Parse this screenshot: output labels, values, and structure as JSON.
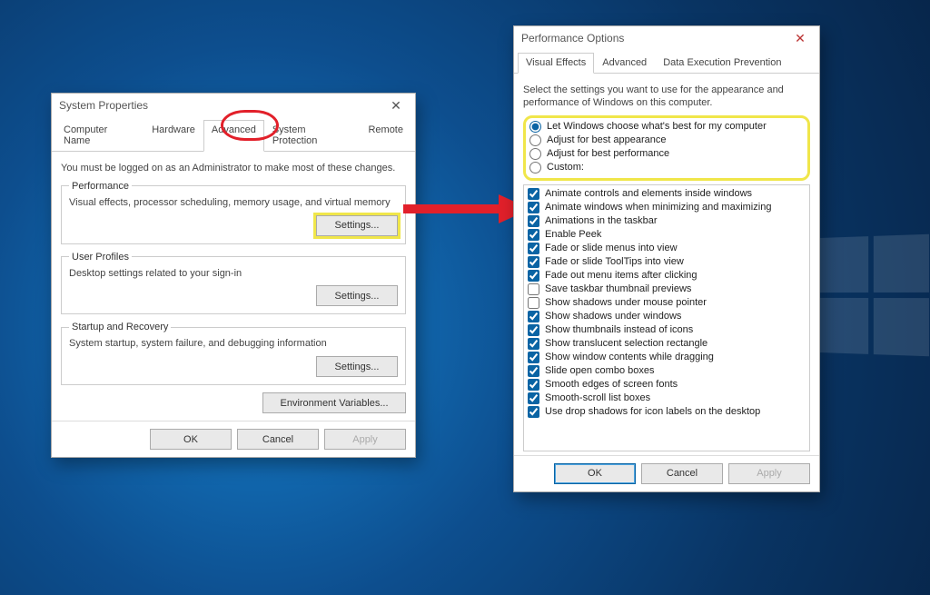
{
  "sysprops": {
    "title": "System Properties",
    "tabs": [
      "Computer Name",
      "Hardware",
      "Advanced",
      "System Protection",
      "Remote"
    ],
    "active_tab": 2,
    "admin_note": "You must be logged on as an Administrator to make most of these changes.",
    "groups": {
      "perf": {
        "legend": "Performance",
        "text": "Visual effects, processor scheduling, memory usage, and virtual memory",
        "btn": "Settings..."
      },
      "profiles": {
        "legend": "User Profiles",
        "text": "Desktop settings related to your sign-in",
        "btn": "Settings..."
      },
      "startup": {
        "legend": "Startup and Recovery",
        "text": "System startup, system failure, and debugging information",
        "btn": "Settings..."
      }
    },
    "env_btn": "Environment Variables...",
    "buttons": {
      "ok": "OK",
      "cancel": "Cancel",
      "apply": "Apply"
    }
  },
  "perfopts": {
    "title": "Performance Options",
    "tabs": [
      "Visual Effects",
      "Advanced",
      "Data Execution Prevention"
    ],
    "active_tab": 0,
    "intro": "Select the settings you want to use for the appearance and performance of Windows on this computer.",
    "radios": [
      {
        "label": "Let Windows choose what's best for my computer",
        "checked": true
      },
      {
        "label": "Adjust for best appearance",
        "checked": false
      },
      {
        "label": "Adjust for best performance",
        "checked": false
      },
      {
        "label": "Custom:",
        "checked": false
      }
    ],
    "checks": [
      {
        "label": "Animate controls and elements inside windows",
        "checked": true
      },
      {
        "label": "Animate windows when minimizing and maximizing",
        "checked": true
      },
      {
        "label": "Animations in the taskbar",
        "checked": true
      },
      {
        "label": "Enable Peek",
        "checked": true
      },
      {
        "label": "Fade or slide menus into view",
        "checked": true
      },
      {
        "label": "Fade or slide ToolTips into view",
        "checked": true
      },
      {
        "label": "Fade out menu items after clicking",
        "checked": true
      },
      {
        "label": "Save taskbar thumbnail previews",
        "checked": false
      },
      {
        "label": "Show shadows under mouse pointer",
        "checked": false
      },
      {
        "label": "Show shadows under windows",
        "checked": true
      },
      {
        "label": "Show thumbnails instead of icons",
        "checked": true
      },
      {
        "label": "Show translucent selection rectangle",
        "checked": true
      },
      {
        "label": "Show window contents while dragging",
        "checked": true
      },
      {
        "label": "Slide open combo boxes",
        "checked": true
      },
      {
        "label": "Smooth edges of screen fonts",
        "checked": true
      },
      {
        "label": "Smooth-scroll list boxes",
        "checked": true
      },
      {
        "label": "Use drop shadows for icon labels on the desktop",
        "checked": true
      }
    ],
    "buttons": {
      "ok": "OK",
      "cancel": "Cancel",
      "apply": "Apply"
    }
  }
}
